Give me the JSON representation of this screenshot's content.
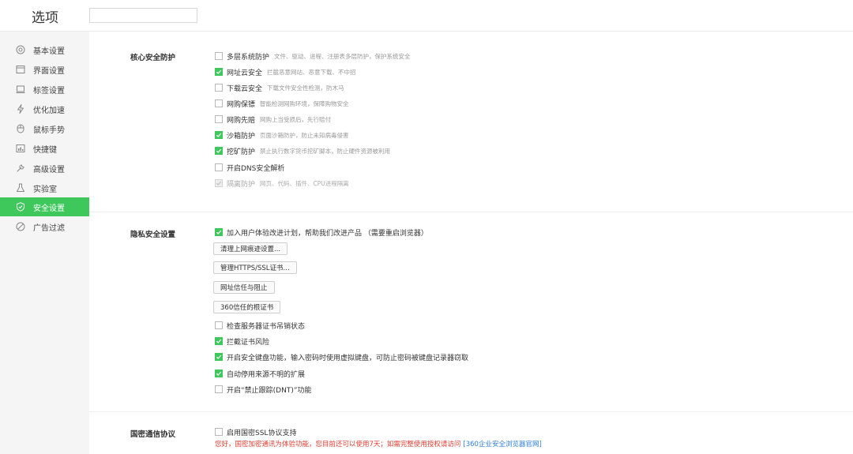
{
  "header": {
    "title": "选项",
    "search_value": ""
  },
  "colors": {
    "accent": "#3ec85c",
    "warning": "#e33b2e",
    "link": "#2e7fd7"
  },
  "sidebar": {
    "items": [
      {
        "label": "基本设置",
        "icon": "target-icon",
        "active": false
      },
      {
        "label": "界面设置",
        "icon": "window-icon",
        "active": false
      },
      {
        "label": "标签设置",
        "icon": "tab-icon",
        "active": false
      },
      {
        "label": "优化加速",
        "icon": "lightning-icon",
        "active": false
      },
      {
        "label": "鼠标手势",
        "icon": "mouse-icon",
        "active": false
      },
      {
        "label": "快捷键",
        "icon": "keyboard-icon",
        "active": false
      },
      {
        "label": "高级设置",
        "icon": "wrench-icon",
        "active": false
      },
      {
        "label": "实验室",
        "icon": "flask-icon",
        "active": false
      },
      {
        "label": "安全设置",
        "icon": "shield-icon",
        "active": true
      },
      {
        "label": "广告过滤",
        "icon": "block-icon",
        "active": false
      }
    ]
  },
  "core": {
    "title": "核心安全防护",
    "options": [
      {
        "label": "多层系统防护",
        "desc": "文件、驱动、进程、注册表多层防护，保护系统安全",
        "checked": false,
        "disabled": false
      },
      {
        "label": "网址云安全",
        "desc": "拦截恶意网站、恶意下载、不中招",
        "checked": true,
        "disabled": false
      },
      {
        "label": "下载云安全",
        "desc": "下载文件安全性检测，防木马",
        "checked": false,
        "disabled": false
      },
      {
        "label": "网购保镖",
        "desc": "智能检测网购环境，保障购物安全",
        "checked": false,
        "disabled": false
      },
      {
        "label": "网购先赔",
        "desc": "网购上当受损后，先行赔付",
        "checked": false,
        "disabled": false
      },
      {
        "label": "沙箱防护",
        "desc": "页面沙箱防护，防止未知病毒侵害",
        "checked": true,
        "disabled": false
      },
      {
        "label": "挖矿防护",
        "desc": "禁止执行数字货币挖矿脚本，防止硬件资源被利用",
        "checked": true,
        "disabled": false
      },
      {
        "label": "开启DNS安全解析",
        "desc": "",
        "checked": false,
        "disabled": false
      },
      {
        "label": "隔离防护",
        "desc": "网页、代码、插件、CPU进程隔离",
        "checked": false,
        "disabled": true
      }
    ]
  },
  "privacy": {
    "title": "隐私安全设置",
    "experience": {
      "label": "加入用户体验改进计划，帮助我们改进产品 （需要重启浏览器）",
      "checked": true
    },
    "buttons": {
      "clear_traces": "清理上网痕迹设置...",
      "manage_https": "管理HTTPS/SSL证书...",
      "trust_block": "网址信任与阻止",
      "root_cert": "360信任的根证书"
    },
    "options": [
      {
        "label": "检查服务器证书吊销状态",
        "checked": false
      },
      {
        "label": "拦截证书风险",
        "checked": true
      },
      {
        "label": "开启安全键盘功能，输入密码时使用虚拟键盘，可防止密码被键盘记录器窃取",
        "checked": true
      },
      {
        "label": "自动停用来源不明的扩展",
        "checked": true
      },
      {
        "label": "开启“禁止跟踪(DNT)”功能",
        "checked": false
      }
    ]
  },
  "national": {
    "title": "国密通信协议",
    "ssl_option": {
      "label": "启用国密SSL协议支持",
      "checked": false
    },
    "warning": "您好，国密加密通讯为体验功能，您目前还可以使用7天；如需完整使用授权请访问",
    "link": "[360企业安全浏览器官网]"
  }
}
